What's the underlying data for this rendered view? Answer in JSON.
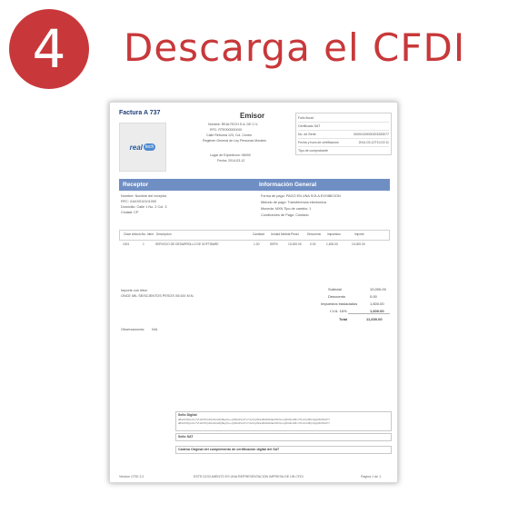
{
  "step": {
    "number": "4",
    "title": "Descarga el CFDI"
  },
  "invoice": {
    "doc_title": "Factura A 737",
    "logo": {
      "word": "real",
      "pill": "tech"
    },
    "emisor": {
      "title": "Emisor",
      "lines": [
        "Nombre: REALTECH S.A. DE C.V.",
        "RFC: RTE000000XX0",
        "Calle Reforma 123, Col. Centro",
        "Regimen General de Ley Personas Morales",
        "Lugar de Expedicion: 06000",
        "Fecha: 2014-03-12"
      ]
    },
    "info_box": [
      {
        "label": "Folio fiscal:",
        "value": ""
      },
      {
        "label": "Certificado SAT",
        "value": ""
      },
      {
        "label": "No. de Serie:",
        "value": "00001000000203253077"
      },
      {
        "label": "Fecha y hora de certificacion",
        "value": "2014-03-12T10:22:11"
      },
      {
        "label": "Tipo de comprobante",
        "value": ""
      }
    ],
    "receptor": {
      "title": "Receptor",
      "fields": [
        "Nombre: Nombre del receptor",
        "RFC: XAXX010101000",
        "Domicilio: Calle 1 No. 2 Col. 3",
        "Ciudad: CP"
      ]
    },
    "general": {
      "title": "Información General",
      "fields": [
        "Forma de pago: PAGO EN UNA SOLA EXHIBICION",
        "Metodo de pago: Transferencia electronica",
        "Moneda: MXN   Tipo de cambio: 1",
        "Condiciones de Pago: Contado"
      ]
    },
    "table": {
      "headers": [
        "Clave Articulo",
        "No. Ident",
        "Descripcion",
        "Cantidad",
        "Unidad Medida",
        "Precio",
        "Descuento",
        "Impuestos",
        "Importe"
      ],
      "row": [
        "1001",
        "1",
        "SERVICIO DE DESARROLLO DE SOFTWARE",
        "1.00",
        "SERV",
        "10,000.00",
        "0.00",
        "1,600.00",
        "10,000.00"
      ]
    },
    "amount_words_label": "Importe con letra:",
    "amount_words": "ONCE MIL SEISCIENTOS PESOS 00/100 M.N.",
    "note_label": "Observaciones:",
    "note_value": "N/A",
    "totals": [
      {
        "label": "Subtotal",
        "value": "10,000.00"
      },
      {
        "label": "Descuento",
        "value": "0.00"
      },
      {
        "label": "Impuestos trasladados",
        "value": "1,600.00"
      },
      {
        "label": "I.V.A. 16%",
        "value": "1,600.00"
      },
      {
        "label": "Total",
        "value": "11,600.00"
      }
    ],
    "sello_title": "Sello Digital",
    "sello_text": "aB3xK9fQm2Lr7Vt1Wz8Yp4Nc6Hs0Dj5Eg/Ku+Ql3Ro9Sx2Tv7Uw1Xy8Za4Bc6Dd0Ee5Ff/Gh+Ij3Kk9Ll2Mm7Nn1Oo8Pp4Qq6Rr0Ss5Tt",
    "sello_sat_label": "Sello SAT",
    "cadena_title": "Cadena Original del complemento de certificación digital del SAT",
    "footer": {
      "left": "Version CFDI 3.2",
      "center": "ESTE DOCUMENTO ES UNA REPRESENTACION IMPRESA DE UN CFDI",
      "right": "Pagina 1 de 1"
    }
  }
}
